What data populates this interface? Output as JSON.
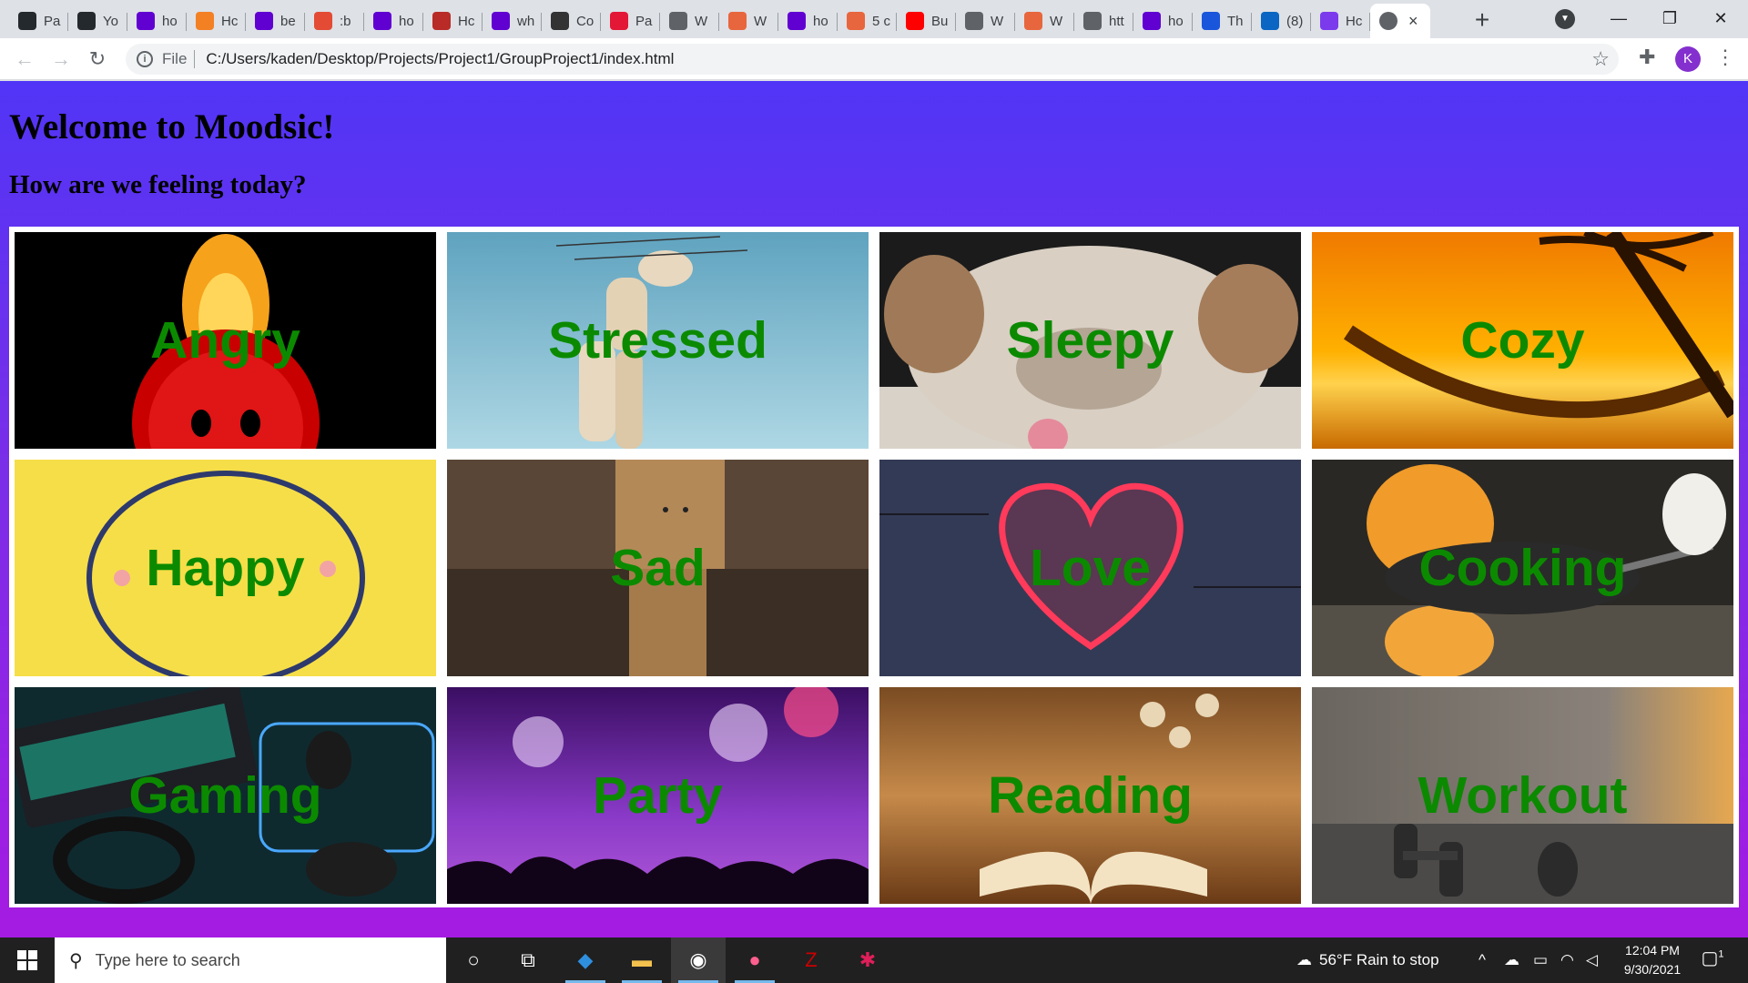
{
  "browser": {
    "tabs": [
      {
        "label": "Pa",
        "icon": "github-icon",
        "color": "#24292e"
      },
      {
        "label": "Yo",
        "icon": "github-icon",
        "color": "#24292e"
      },
      {
        "label": "ho",
        "icon": "yahoo-icon",
        "color": "#6001d2"
      },
      {
        "label": "Hc",
        "icon": "orange-hat-icon",
        "color": "#f48024"
      },
      {
        "label": "be",
        "icon": "yahoo-icon",
        "color": "#6001d2"
      },
      {
        "label": ":b",
        "icon": "asterisk-icon",
        "color": "#e34b35"
      },
      {
        "label": "ho",
        "icon": "yahoo-icon",
        "color": "#6001d2"
      },
      {
        "label": "Hc",
        "icon": "quora-icon",
        "color": "#b92b27"
      },
      {
        "label": "wh",
        "icon": "yahoo-icon",
        "color": "#6001d2"
      },
      {
        "label": "Co",
        "icon": "sa-icon",
        "color": "#333333"
      },
      {
        "label": "Pa",
        "icon": "n-icon",
        "color": "#e31837"
      },
      {
        "label": "W",
        "icon": "globe-icon",
        "color": "#5f6368"
      },
      {
        "label": "W",
        "icon": "cloud-icon",
        "color": "#e8663d"
      },
      {
        "label": "ho",
        "icon": "yahoo-icon",
        "color": "#6001d2"
      },
      {
        "label": "5 c",
        "icon": "cloud-icon",
        "color": "#e8663d"
      },
      {
        "label": "Bu",
        "icon": "youtube-icon",
        "color": "#ff0000"
      },
      {
        "label": "W",
        "icon": "globe-icon",
        "color": "#5f6368"
      },
      {
        "label": "W",
        "icon": "cloud-icon",
        "color": "#e8663d"
      },
      {
        "label": "htt",
        "icon": "globe-icon",
        "color": "#5f6368"
      },
      {
        "label": "ho",
        "icon": "yahoo-icon",
        "color": "#6001d2"
      },
      {
        "label": "Th",
        "icon": "js-icon",
        "color": "#1a56db"
      },
      {
        "label": "(8)",
        "icon": "linkedin-icon",
        "color": "#0a66c2"
      },
      {
        "label": "Hc",
        "icon": "purple-circle-icon",
        "color": "#7c3aed"
      }
    ],
    "active_tab_close": "×",
    "new_tab": "+",
    "window_controls": {
      "minimize": "—",
      "restore": "❐",
      "close": "✕"
    },
    "address": {
      "scheme_label": "File",
      "url": "C:/Users/kaden/Desktop/Projects/Project1/GroupProject1/index.html"
    },
    "profile_initial": "K"
  },
  "page": {
    "title": "Welcome to Moodsic!",
    "subtitle": "How are we feeling today?",
    "moods": [
      {
        "label": "Angry"
      },
      {
        "label": "Stressed"
      },
      {
        "label": "Sleepy"
      },
      {
        "label": "Cozy"
      },
      {
        "label": "Happy"
      },
      {
        "label": "Sad"
      },
      {
        "label": "Love"
      },
      {
        "label": "Cooking"
      },
      {
        "label": "Gaming"
      },
      {
        "label": "Party"
      },
      {
        "label": "Reading"
      },
      {
        "label": "Workout"
      }
    ]
  },
  "taskbar": {
    "search_placeholder": "Type here to search",
    "weather": "56°F  Rain to stop",
    "time": "12:04 PM",
    "date": "9/30/2021",
    "notification_count": "1"
  }
}
